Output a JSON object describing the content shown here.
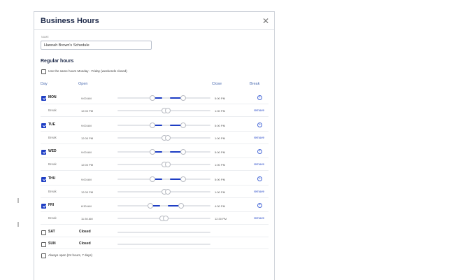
{
  "dialog": {
    "title": "Business Hours",
    "close_icon": "close-icon"
  },
  "name_field": {
    "label": "NAME",
    "value": "Hannah Brown's Schedule"
  },
  "regular_hours": {
    "heading": "Regular hours",
    "same_hours_label": "Use the same hours Monday - Friday (weekends closed)",
    "same_hours_checked": false,
    "columns": {
      "day": "Day",
      "open": "Open",
      "close": "Close",
      "break": "Break"
    },
    "days": [
      {
        "name": "MON",
        "checked": true,
        "open": "9:00 AM",
        "close": "5:00 PM",
        "break_label": "Break",
        "break_start": "12:00 PM",
        "break_end": "1:00 PM",
        "remove_label": "remove"
      },
      {
        "name": "TUE",
        "checked": true,
        "open": "9:00 AM",
        "close": "5:00 PM",
        "break_label": "Break",
        "break_start": "12:00 PM",
        "break_end": "1:00 PM",
        "remove_label": "remove"
      },
      {
        "name": "WED",
        "checked": true,
        "open": "9:00 AM",
        "close": "5:00 PM",
        "break_label": "Break",
        "break_start": "12:00 PM",
        "break_end": "1:00 PM",
        "remove_label": "remove"
      },
      {
        "name": "THU",
        "checked": true,
        "open": "9:00 AM",
        "close": "5:00 PM",
        "break_label": "Break",
        "break_start": "12:00 PM",
        "break_end": "1:00 PM",
        "remove_label": "remove"
      },
      {
        "name": "FRI",
        "checked": true,
        "open": "8:30 AM",
        "close": "4:30 PM",
        "break_label": "Break",
        "break_start": "11:30 AM",
        "break_end": "12:30 PM",
        "remove_label": "remove"
      },
      {
        "name": "SAT",
        "checked": false,
        "status": "Closed"
      },
      {
        "name": "SUN",
        "checked": false,
        "status": "Closed"
      }
    ],
    "always_open_label": "Always open (24 hours, 7 days)",
    "always_open_checked": false
  },
  "colors": {
    "accent": "#1e3ec4",
    "header_text": "#4a6bb0",
    "title_text": "#1e2a4a"
  }
}
